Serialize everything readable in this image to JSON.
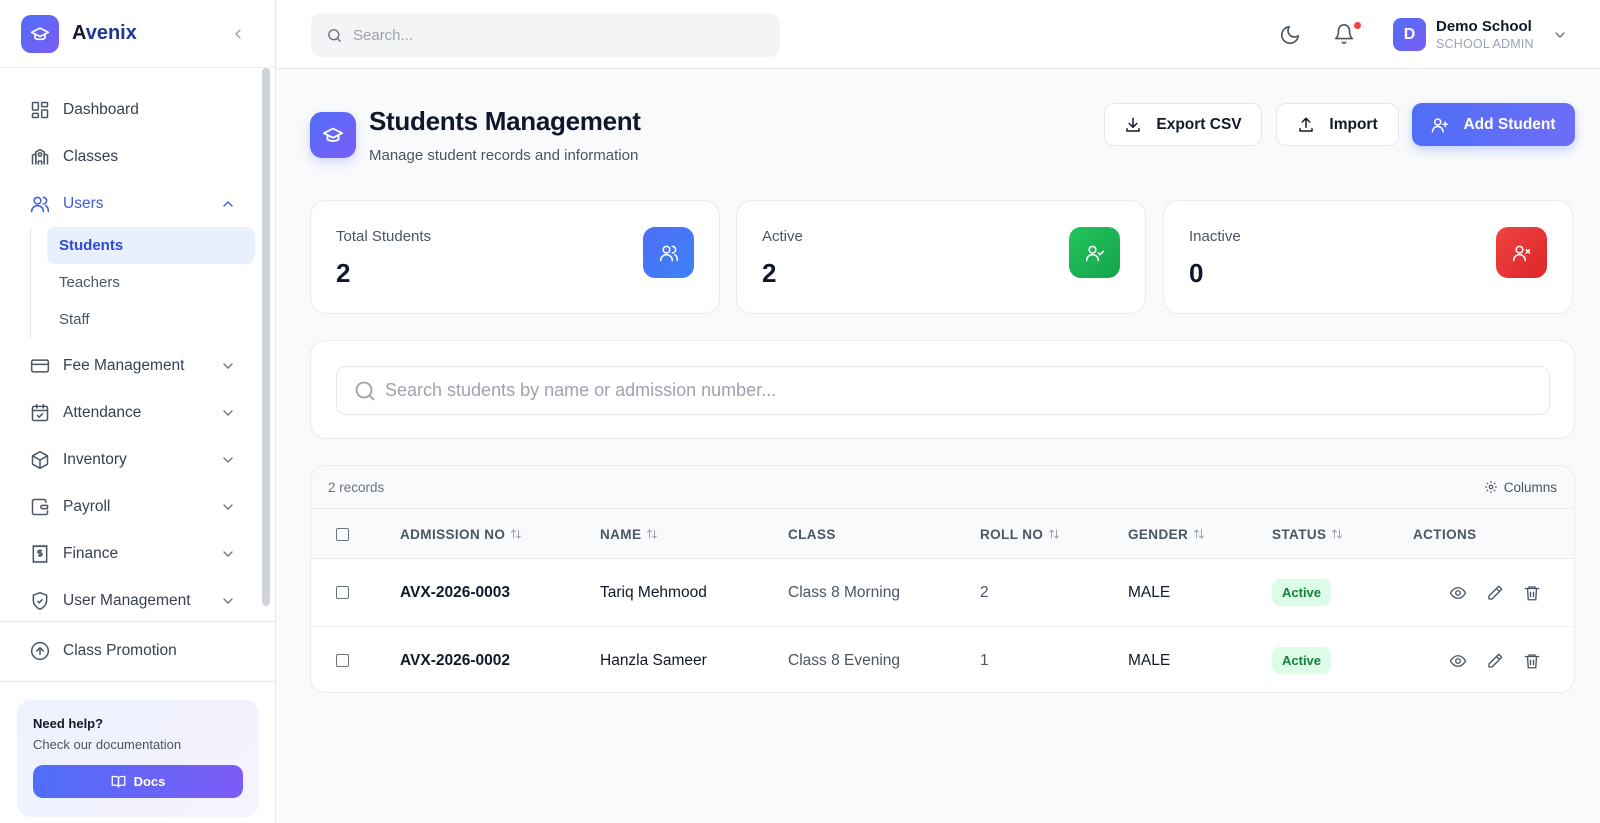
{
  "brand": {
    "first_letter": "A",
    "rest": "venix"
  },
  "sidebar": {
    "items": [
      {
        "label": "Dashboard",
        "icon": "dashboard-icon"
      },
      {
        "label": "Classes",
        "icon": "school-icon"
      },
      {
        "label": "Users",
        "icon": "users-icon",
        "expanded": true,
        "children": [
          "Students",
          "Teachers",
          "Staff"
        ],
        "active_child": "Students"
      },
      {
        "label": "Fee Management",
        "icon": "credit-card-icon"
      },
      {
        "label": "Attendance",
        "icon": "calendar-check-icon"
      },
      {
        "label": "Inventory",
        "icon": "box-icon"
      },
      {
        "label": "Payroll",
        "icon": "wallet-icon"
      },
      {
        "label": "Finance",
        "icon": "receipt-icon"
      },
      {
        "label": "User Management",
        "icon": "shield-icon"
      }
    ],
    "promotion": {
      "label": "Class Promotion",
      "icon": "arrow-up-circle-icon"
    },
    "help": {
      "title": "Need help?",
      "subtitle": "Check our documentation",
      "button": "Docs"
    }
  },
  "topbar": {
    "search_placeholder": "Search...",
    "user": {
      "initial": "D",
      "name": "Demo School",
      "role": "SCHOOL ADMIN"
    }
  },
  "page": {
    "title": "Students Management",
    "subtitle": "Manage student records and information",
    "actions": {
      "export": "Export CSV",
      "import": "Import",
      "add": "Add Student"
    }
  },
  "stats": [
    {
      "label": "Total Students",
      "value": "2",
      "color": "#4f6ef7",
      "icon": "users-icon"
    },
    {
      "label": "Active",
      "value": "2",
      "color": "#16a34a",
      "icon": "user-check-icon"
    },
    {
      "label": "Inactive",
      "value": "0",
      "color": "#dc2626",
      "icon": "user-x-icon"
    }
  ],
  "search": {
    "placeholder": "Search students by name or admission number..."
  },
  "table": {
    "records": "2 records",
    "columns_label": "Columns",
    "headers": {
      "admission_no": "ADMISSION NO",
      "name": "NAME",
      "class": "CLASS",
      "roll_no": "ROLL NO",
      "gender": "GENDER",
      "status": "STATUS",
      "actions": "ACTIONS"
    },
    "rows": [
      {
        "admission_no": "AVX-2026-0003",
        "name": "Tariq Mehmood",
        "class": "Class 8 Morning",
        "roll_no": "2",
        "gender": "MALE",
        "status": "Active"
      },
      {
        "admission_no": "AVX-2026-0002",
        "name": "Hanzla Sameer",
        "class": "Class 8 Evening",
        "roll_no": "1",
        "gender": "MALE",
        "status": "Active"
      }
    ]
  }
}
